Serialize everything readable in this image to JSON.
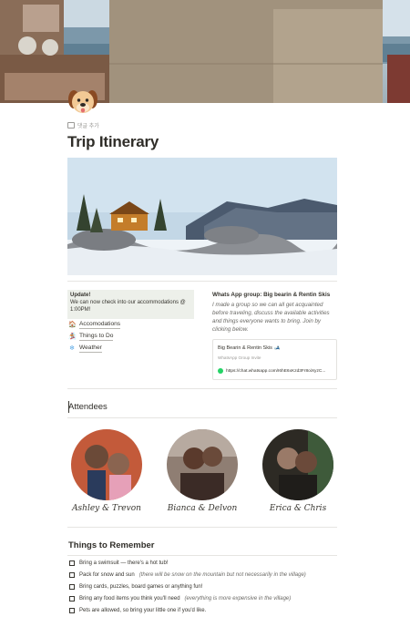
{
  "page": {
    "title": "Trip Itinerary",
    "add_comment": "댓글 추가",
    "page_icon": "dog-face-icon"
  },
  "callout": {
    "heading": "Update!",
    "body": "We can now check into our accommodations @ 1:00PM!"
  },
  "links": [
    {
      "label": "Accomodations",
      "icon": "house-icon"
    },
    {
      "label": "Things to Do",
      "icon": "snowboarder-icon"
    },
    {
      "label": "Weather",
      "icon": "snowflake-icon"
    }
  ],
  "whatsapp": {
    "heading": "Whats App group: Big bearin & Rentin Skis",
    "body": "I made a group so we can all get acquainted before traveling, discuss the available activities and things everyone wants to bring. Join by clicking below.",
    "bookmark_title": "Big Bearin & Rentin Skis 🎿",
    "bookmark_subtitle": "WhatsApp Group Invite",
    "bookmark_url": "https://chat.whatsapp.com/I6hE6xKzd3Fr8oiXyzC..."
  },
  "attendees": {
    "heading": "Attendees",
    "people": [
      {
        "caption": "Ashley & Trevon"
      },
      {
        "caption": "Bianca & Delvon"
      },
      {
        "caption": "Erica & Chris"
      }
    ]
  },
  "checklist": {
    "heading": "Things to Remember",
    "items": [
      {
        "text": "Bring a swimsuit — there's a hot tub!",
        "note": ""
      },
      {
        "text": "Pack for snow and sun",
        "note": "(there will be snow on the mountain but not necessarily in the village)"
      },
      {
        "text": "Bring cards, puzzles, board games or anything fun!",
        "note": ""
      },
      {
        "text": "Bring any food items you think you'll need",
        "note": "(everything is more expensive in the village)"
      },
      {
        "text": "Pets are allowed, so bring your little one if you'd like.",
        "note": ""
      }
    ]
  }
}
